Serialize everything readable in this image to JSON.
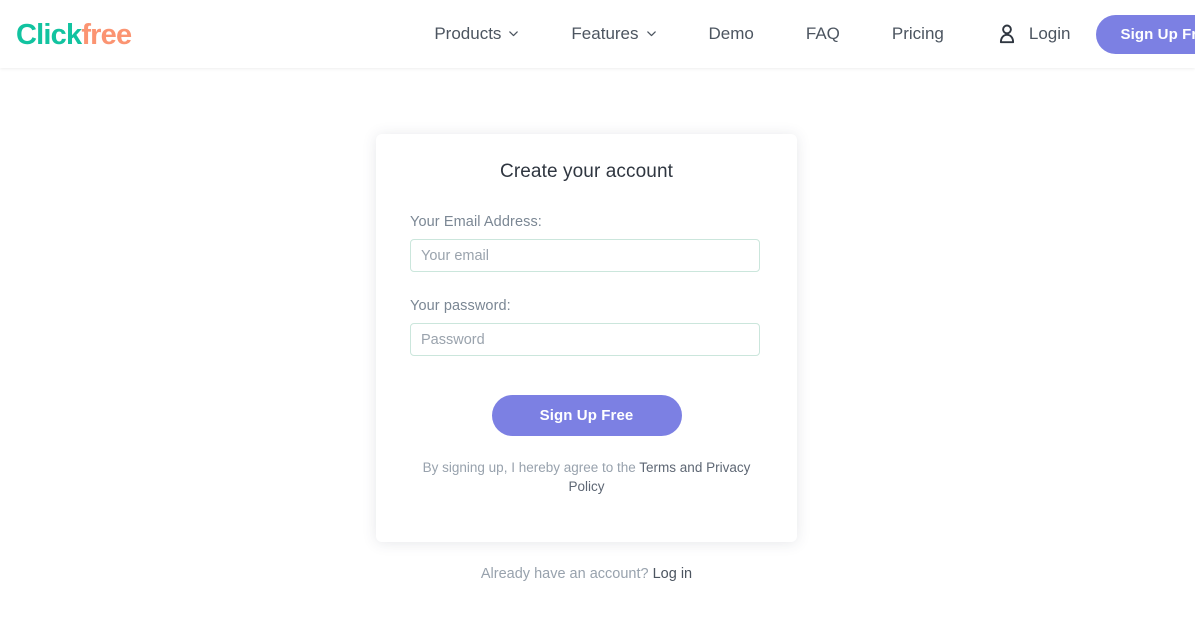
{
  "header": {
    "brand": {
      "part_one": "Click",
      "part_two": "free",
      "color_one": "#12c3a0",
      "color_two": "#fb9472"
    },
    "nav": [
      {
        "label": "Products",
        "has_dropdown": true,
        "icon": "chevron-down-icon"
      },
      {
        "label": "Features",
        "has_dropdown": true,
        "icon": "chevron-down-icon"
      },
      {
        "label": "Demo",
        "has_dropdown": false,
        "icon": ""
      },
      {
        "label": "FAQ",
        "has_dropdown": false,
        "icon": ""
      },
      {
        "label": "Pricing",
        "has_dropdown": false,
        "icon": ""
      }
    ],
    "user_icon": "user-icon",
    "login_label": "Login",
    "signup_label": "Sign Up Free",
    "accent_color": "#7c80e3"
  },
  "card": {
    "title": "Create your account",
    "email": {
      "label": "Your Email Address:",
      "placeholder": "Your email",
      "value": ""
    },
    "password": {
      "label": "Your password:",
      "placeholder": "Password",
      "value": ""
    },
    "submit_label": "Sign Up Free",
    "terms": {
      "prefix": "By signing up, I hereby agree to the ",
      "link": "Terms and Privacy Policy"
    },
    "border_color": "#cbe6dc"
  },
  "footer": {
    "prompt": "Already have an account? ",
    "login_link": "Log in"
  }
}
